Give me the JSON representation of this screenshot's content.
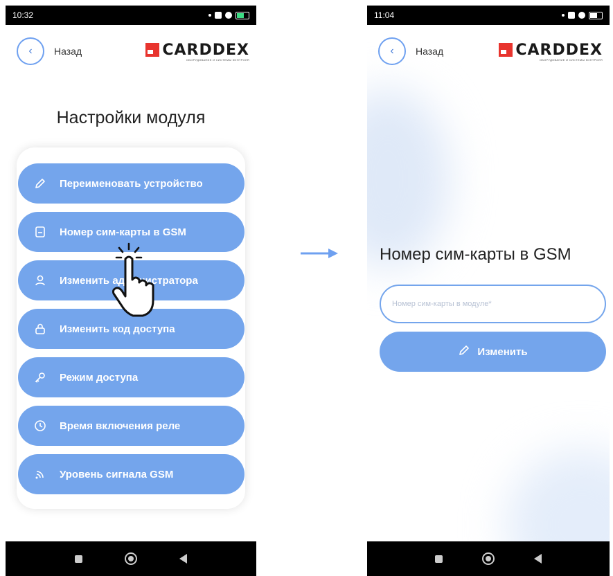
{
  "screen1": {
    "status_time": "10:32",
    "back_label": "Назад",
    "logo_text": "CARDDEX",
    "logo_subtitle": "ОБОРУДОВАНИЕ И СИСТЕМЫ КОНТРОЛЯ",
    "title": "Настройки модуля",
    "menu": [
      {
        "label": "Переименовать устройство",
        "icon": "pencil-icon"
      },
      {
        "label": "Номер сим-карты в GSM",
        "icon": "sim-card-icon"
      },
      {
        "label": "Изменить администратора",
        "icon": "user-icon"
      },
      {
        "label": "Изменить код доступа",
        "icon": "lock-icon"
      },
      {
        "label": "Режим доступа",
        "icon": "key-icon"
      },
      {
        "label": "Время включения реле",
        "icon": "clock-icon"
      },
      {
        "label": "Уровень сигнала GSM",
        "icon": "signal-icon"
      }
    ],
    "pointer_icon": "tap-hand-icon"
  },
  "screen2": {
    "status_time": "11:04",
    "back_label": "Назад",
    "logo_text": "CARDDEX",
    "logo_subtitle": "ОБОРУДОВАНИЕ И СИСТЕМЫ КОНТРОЛЯ",
    "title": "Номер сим-карты в GSM",
    "input": {
      "value": "",
      "placeholder": "Номер сим-карты в модуле*"
    },
    "submit_label": "Изменить",
    "submit_icon": "pencil-icon"
  },
  "transition_icon": "arrow-right-icon",
  "colors": {
    "accent": "#74a5ec",
    "logo_red": "#e8342e",
    "status_bar": "#000000"
  }
}
